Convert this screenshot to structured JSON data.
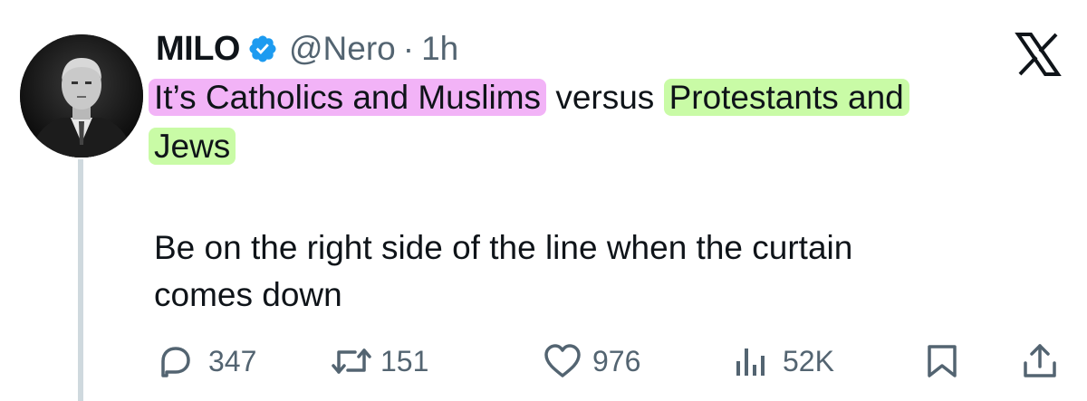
{
  "author": {
    "name": "MILO",
    "handle": "@Nero",
    "separator": "·",
    "time": "1h"
  },
  "tweet": {
    "line1_pink": "It’s Catholics and Muslims",
    "line1_plain": "versus",
    "line1_green": "Protestants and",
    "line2_green": "Jews",
    "line3": "Be on the right side of the line when the curtain",
    "line4": "comes down"
  },
  "metrics": {
    "replies": "347",
    "retweets": "151",
    "likes": "976",
    "views": "52K"
  },
  "icons": {
    "platform": "x-logo-icon",
    "verified": "verified-badge-icon",
    "reply": "reply-icon",
    "retweet": "retweet-icon",
    "like": "heart-icon",
    "views": "views-icon",
    "bookmark": "bookmark-icon",
    "share": "share-icon"
  },
  "colors": {
    "highlight_pink": "#f2b3f7",
    "highlight_green": "#c9fba6",
    "verified_blue": "#1d9bf0",
    "secondary_text": "#536471"
  }
}
